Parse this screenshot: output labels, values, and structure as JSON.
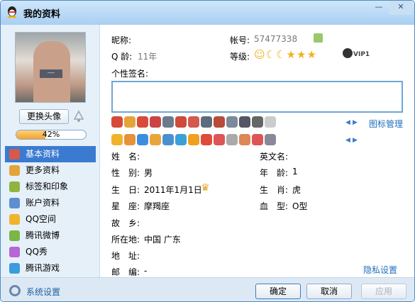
{
  "window": {
    "title": "我的资料",
    "minimize_glyph": "—",
    "close_glyph": "✕"
  },
  "profile": {
    "change_avatar": "更换头像",
    "progress_value": 0.42,
    "progress_label": "42%"
  },
  "nav": [
    {
      "label": "基本资料",
      "icon": "id-card-icon",
      "color": "#d35a4c",
      "active": true
    },
    {
      "label": "更多资料",
      "icon": "document-icon",
      "color": "#e4a43c",
      "active": false
    },
    {
      "label": "标签和印象",
      "icon": "tag-icon",
      "color": "#8fb43f",
      "active": false
    },
    {
      "label": "账户资料",
      "icon": "account-icon",
      "color": "#5d8fd0",
      "active": false
    },
    {
      "label": "QQ空间",
      "icon": "star-icon",
      "color": "#f0b42c",
      "active": false
    },
    {
      "label": "腾讯微博",
      "icon": "weibo-icon",
      "color": "#7ab648",
      "active": false
    },
    {
      "label": "QQ秀",
      "icon": "qqshow-icon",
      "color": "#b766d6",
      "active": false
    },
    {
      "label": "腾讯游戏",
      "icon": "game-icon",
      "color": "#3a9be0",
      "active": false
    }
  ],
  "info": {
    "nickname_label": "昵称:",
    "account_label": "帐号:",
    "account_value": "57477338",
    "qq_age_label": "Q 龄:",
    "qq_age_value": "11年",
    "level_label": "等级:",
    "vip_label": "VIP1",
    "signature_label": "个性签名:",
    "icon_manage": "图标管理"
  },
  "fields": {
    "name_label": "姓　名:",
    "english_name_label": "英文名:",
    "gender_label": "性　别:",
    "gender_value": "男",
    "age_label": "年　龄:",
    "age_value": "1",
    "birthday_label": "生　日:",
    "birthday_value": "2011年1月1日",
    "zodiac_label": "生　肖:",
    "zodiac_value": "虎",
    "constellation_label": "星　座:",
    "constellation_value": "摩羯座",
    "blood_label": "血　型:",
    "blood_value": "O型",
    "hometown_label": "故　乡:",
    "location_label": "所在地:",
    "location_value": "中国 广东",
    "address_label": "地　址:",
    "postcode_label": "邮　编:",
    "postcode_value": "-",
    "privacy": "隐私设置"
  },
  "footer": {
    "settings": "系统设置",
    "ok": "确定",
    "cancel": "取消",
    "apply": "应用"
  },
  "colors": {
    "accent": "#3b7ad1",
    "link": "#1f6fc0",
    "progress": "#f2a32b"
  }
}
